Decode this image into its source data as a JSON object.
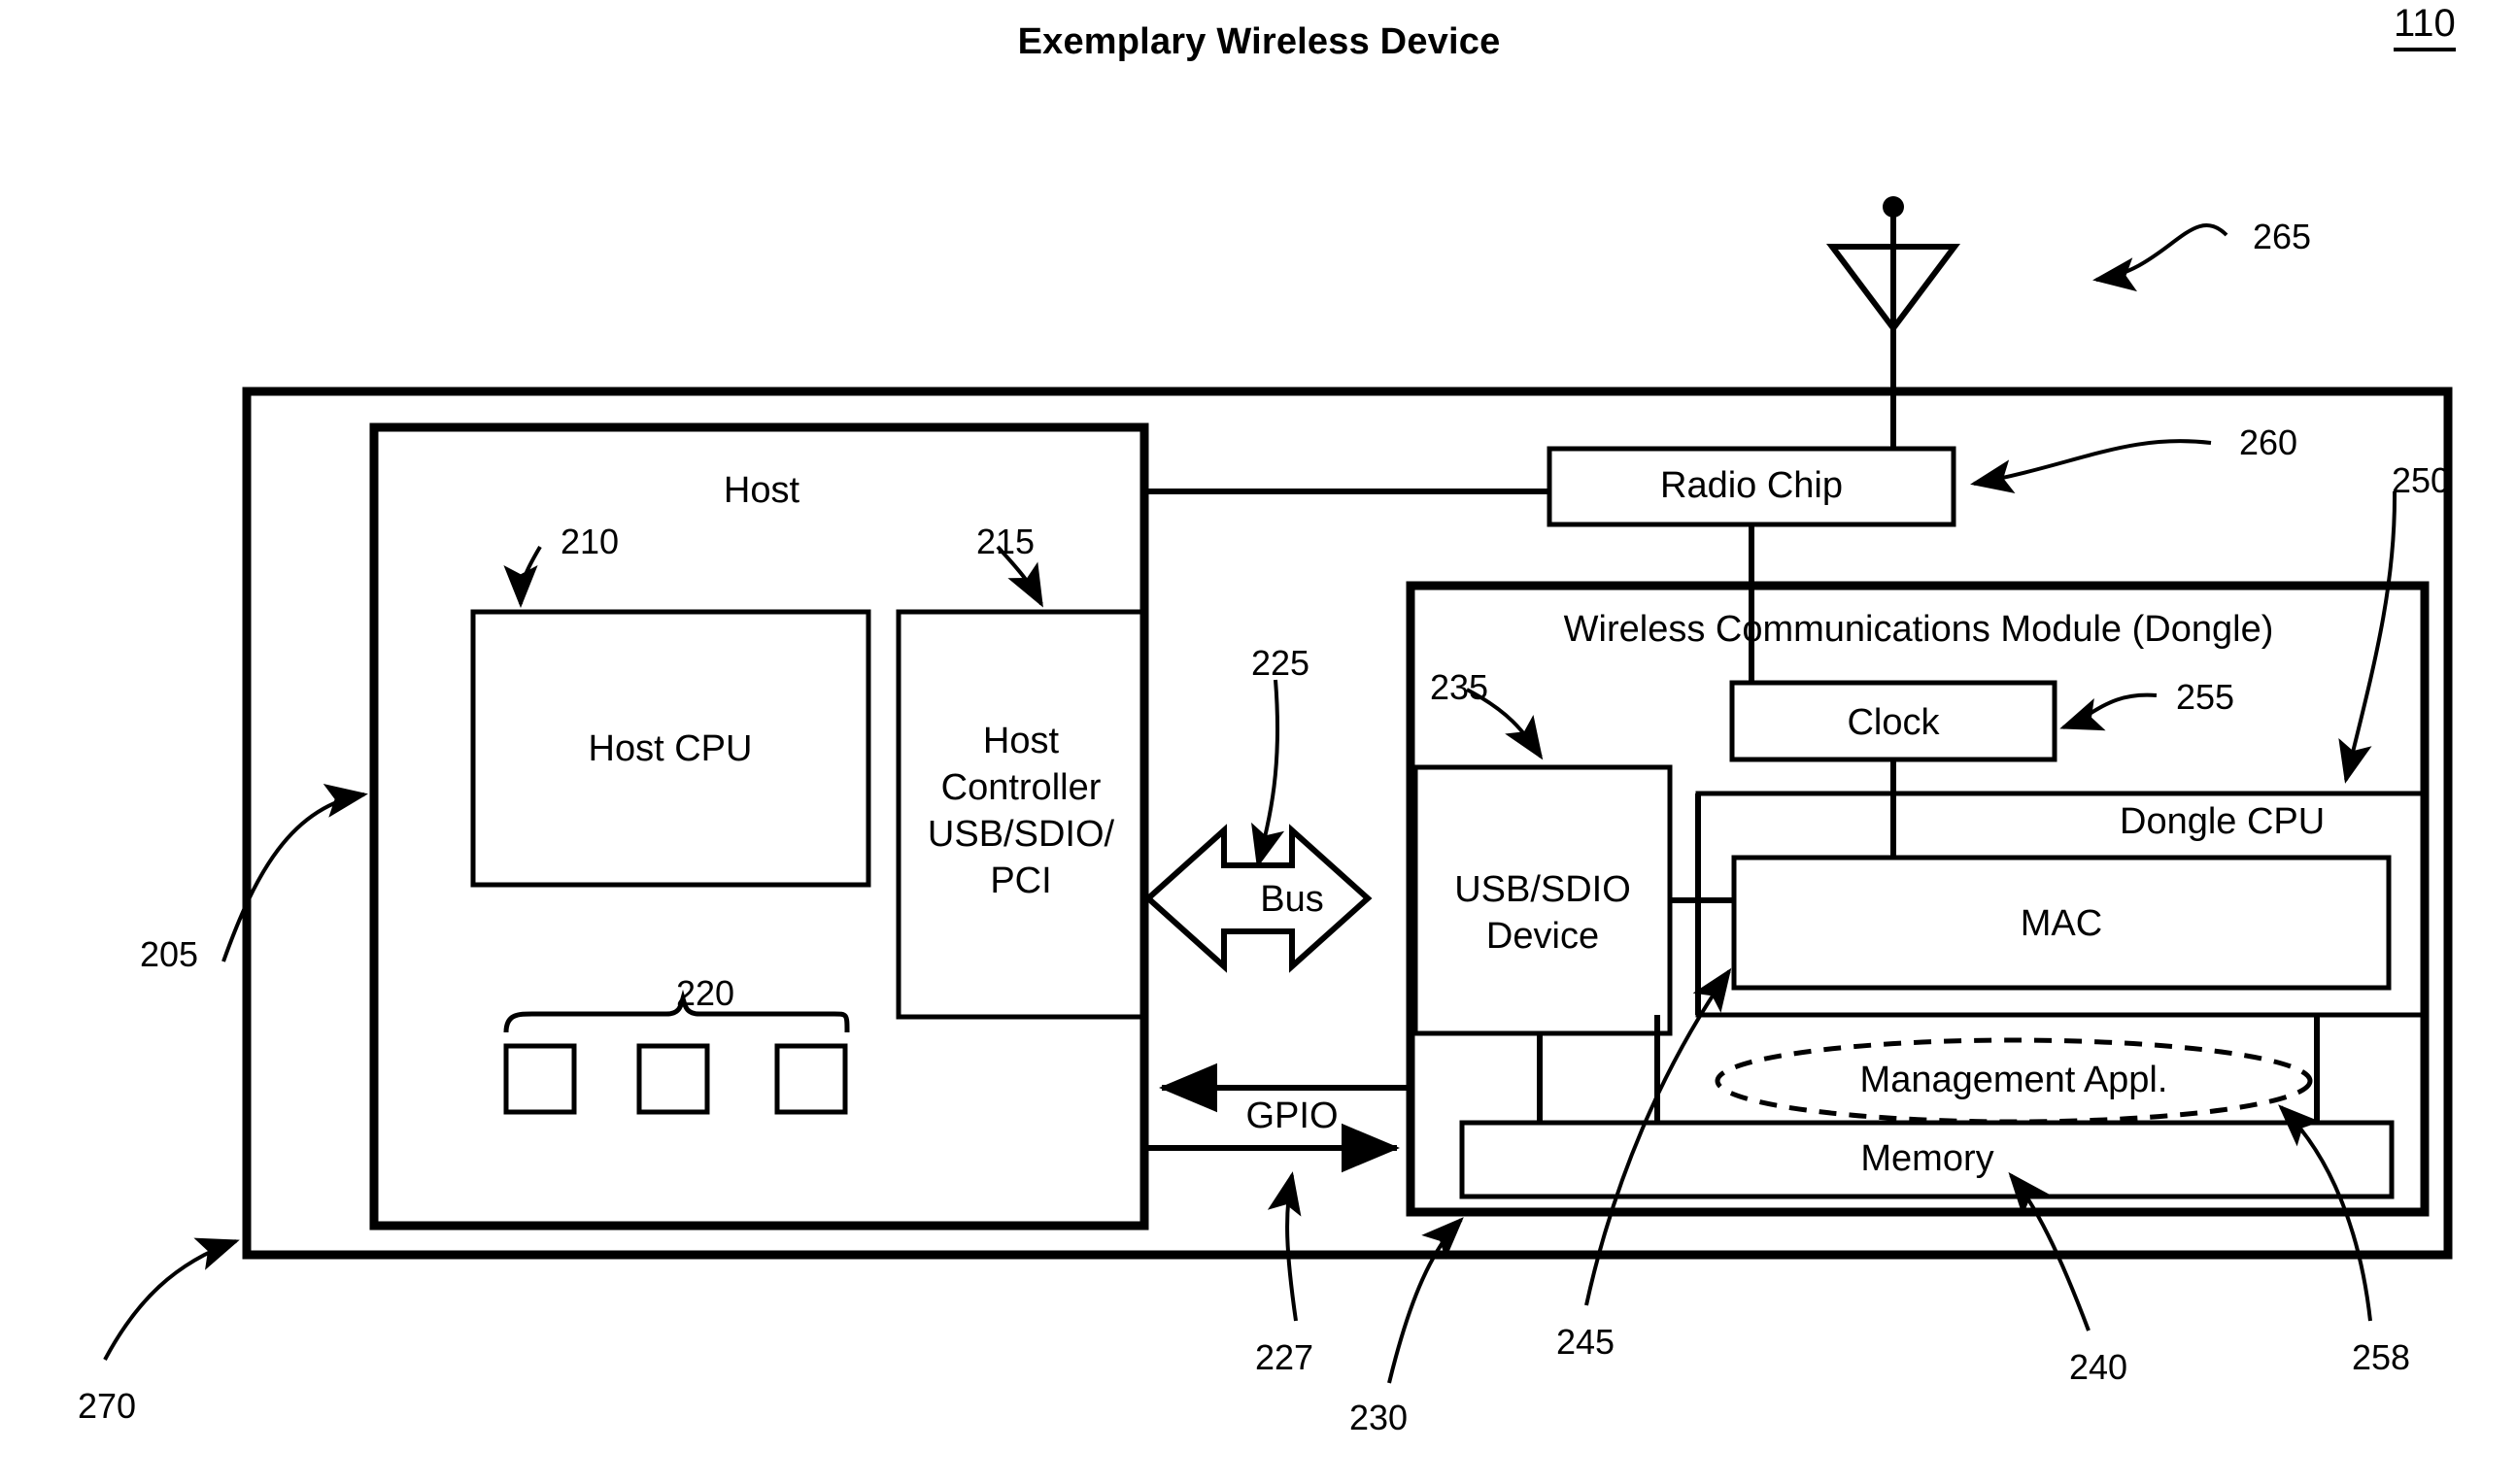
{
  "figure": {
    "title": "Exemplary Wireless Device",
    "number": "110"
  },
  "outer_device": {
    "name": "wireless device enclosure",
    "ref": "270"
  },
  "host": {
    "title": "Host",
    "ref": "205",
    "cpu": {
      "label": "Host CPU",
      "ref": "210"
    },
    "controller": {
      "label": "Host Controller USB/SDIO/ PCI",
      "line1": "Host",
      "line2": "Controller",
      "line3": "USB/SDIO/",
      "line4": "PCI",
      "ref": "215"
    },
    "peripherals": {
      "ref": "220",
      "count": 3
    }
  },
  "bus": {
    "label": "Bus",
    "ref": "225"
  },
  "gpio": {
    "label": "GPIO",
    "ref": "227"
  },
  "dongle": {
    "title": "Wireless Communications Module (Dongle)",
    "ref": "230",
    "usb_device": {
      "line1": "USB/SDIO",
      "line2": "Device",
      "ref": "235"
    },
    "clock": {
      "label": "Clock",
      "ref": "255"
    },
    "cpu": {
      "label": "Dongle CPU",
      "ref": "250"
    },
    "mac": {
      "label": "MAC",
      "ref": "245"
    },
    "management_appl": {
      "label": "Management Appl.",
      "ref": "258"
    },
    "memory": {
      "label": "Memory",
      "ref": "240"
    }
  },
  "radio_chip": {
    "label": "Radio Chip",
    "ref": "260"
  },
  "antenna": {
    "ref": "265"
  },
  "colors": {
    "ink": "#000000",
    "paper": "#ffffff"
  }
}
